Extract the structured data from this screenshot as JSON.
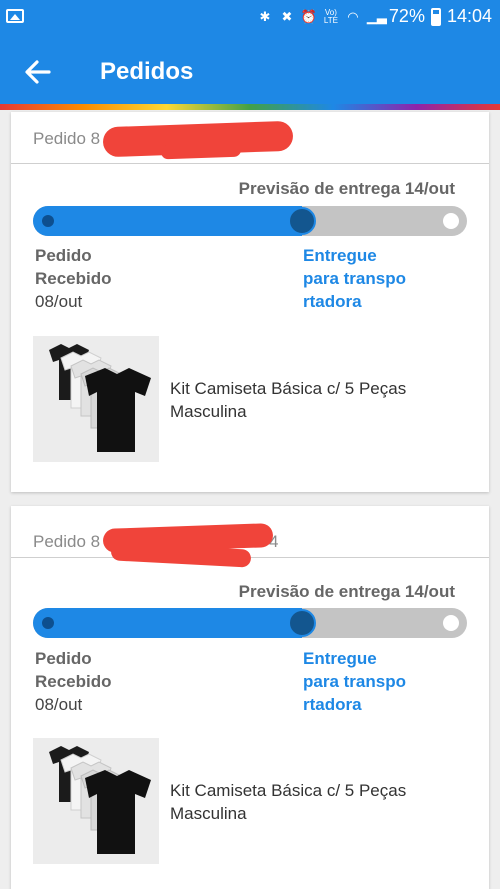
{
  "status_bar": {
    "battery": "72%",
    "time": "14:04",
    "network": "LTE"
  },
  "app_bar": {
    "title": "Pedidos"
  },
  "orders": [
    {
      "order_label": "Pedido 8",
      "eta": "Previsão de entrega 14/out",
      "progress": 0.62,
      "step_received": {
        "line1": "Pedido",
        "line2": "Recebido",
        "date": "08/out"
      },
      "step_current": {
        "line1": "Entregue",
        "line2": "para transpo",
        "line3": "rtadora"
      },
      "product": {
        "line1": "Kit Camiseta Básica c/ 5 Peças",
        "line2": "Masculina"
      }
    },
    {
      "order_label": "Pedido 8",
      "order_label_suffix": "4",
      "eta": "Previsão de entrega 14/out",
      "progress": 0.62,
      "step_received": {
        "line1": "Pedido",
        "line2": "Recebido",
        "date": "08/out"
      },
      "step_current": {
        "line1": "Entregue",
        "line2": "para transpo",
        "line3": "rtadora"
      },
      "product": {
        "line1": "Kit Camiseta Básica c/ 5 Peças",
        "line2": "Masculina"
      }
    }
  ],
  "colors": {
    "primary": "#1e88e5",
    "redaction": "#f0443a",
    "track_bg": "#c4c4c4"
  }
}
